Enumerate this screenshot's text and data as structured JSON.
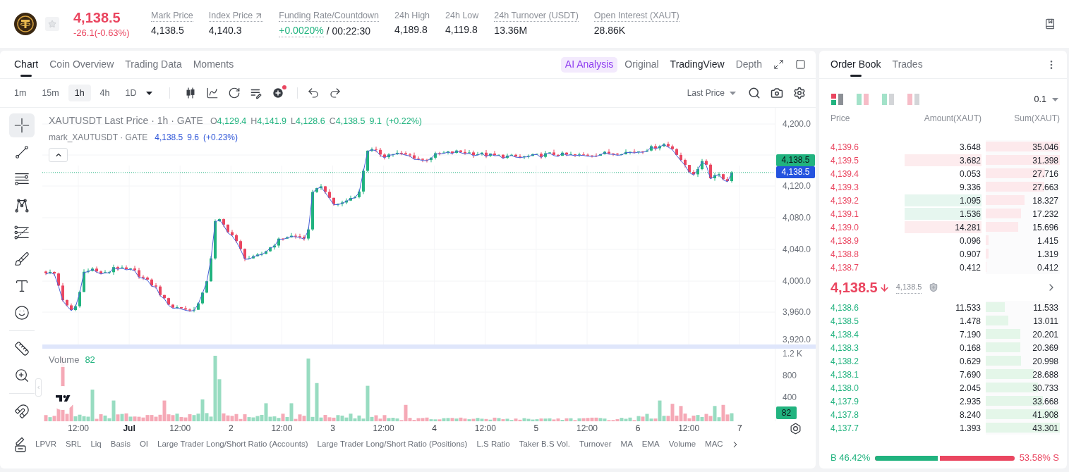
{
  "header": {
    "price": "4,138.5",
    "change": "-26.1(-0.63%)",
    "falling": true,
    "favorite": false,
    "stats": [
      {
        "label": "Mark Price",
        "value": "4,138.5",
        "dotted": true,
        "external_link": false,
        "positive": false
      },
      {
        "label": "Index Price",
        "value": "4,140.3",
        "dotted": true,
        "external_link": true,
        "positive": false
      },
      {
        "label": "Funding Rate/Countdown",
        "value": "+0.0020%",
        "countdown": "/ 00:22:30",
        "dotted": true,
        "external_link": false,
        "positive": true
      },
      {
        "label": "24h High",
        "value": "4,189.8",
        "dotted": false,
        "external_link": false,
        "positive": false
      },
      {
        "label": "24h Low",
        "value": "4,119.8",
        "dotted": false,
        "external_link": false,
        "positive": false
      },
      {
        "label": "24h Turnover (USDT)",
        "value": "13.36M",
        "dotted": true,
        "external_link": false,
        "positive": false
      },
      {
        "label": "Open Interest (XAUT)",
        "value": "28.86K",
        "dotted": true,
        "external_link": false,
        "positive": false
      }
    ]
  },
  "chart": {
    "tabs": [
      {
        "label": "Chart",
        "selected": true
      },
      {
        "label": "Coin Overview",
        "selected": false
      },
      {
        "label": "Trading Data",
        "selected": false
      },
      {
        "label": "Moments",
        "selected": false
      }
    ],
    "views": [
      {
        "label": "AI Analysis",
        "kind": "ai",
        "selected": false
      },
      {
        "label": "Original",
        "kind": "tab",
        "selected": false
      },
      {
        "label": "TradingView",
        "kind": "tab",
        "selected": true
      },
      {
        "label": "Depth",
        "kind": "tab",
        "selected": false
      }
    ],
    "intervals": [
      {
        "label": "1m",
        "selected": false
      },
      {
        "label": "15m",
        "selected": false
      },
      {
        "label": "1h",
        "selected": true
      },
      {
        "label": "4h",
        "selected": false
      },
      {
        "label": "1D",
        "selected": false
      }
    ],
    "toolbar": {
      "price_type": "Last Price",
      "notification_dot": true
    },
    "tools": [
      [
        {
          "kind": "crosshair",
          "selected": true
        },
        {
          "kind": "trend-line",
          "selected": false
        },
        {
          "kind": "parallel-lines",
          "selected": false
        },
        {
          "kind": "pattern",
          "selected": false
        },
        {
          "kind": "fib",
          "selected": false
        },
        {
          "kind": "brush",
          "selected": false
        },
        {
          "kind": "text",
          "selected": false
        },
        {
          "kind": "emoji",
          "selected": false
        }
      ],
      [
        {
          "kind": "ruler",
          "selected": false
        },
        {
          "kind": "zoom",
          "selected": false
        }
      ],
      [
        {
          "kind": "magnet",
          "selected": false
        }
      ]
    ],
    "legend": {
      "title": "XAUTUSDT Last Price · 1h · GATE",
      "positive": true,
      "ohlc": [
        {
          "key": "O",
          "value": "4,129.4"
        },
        {
          "key": "H",
          "value": "4,141.9"
        },
        {
          "key": "L",
          "value": "4,128.6"
        },
        {
          "key": "C",
          "value": "4,138.5"
        }
      ],
      "change": "9.1",
      "change_pct": "(+0.22%)",
      "mark_title": "mark_XAUTUSDT · GATE",
      "mark_values": [
        "4,138.5",
        "9.6",
        "(+0.23%)"
      ]
    },
    "price_axis": [
      "4,200.0",
      "4,120.0",
      "4,080.0",
      "4,040.0",
      "4,000.0",
      "3,960.0",
      "3,920.0"
    ],
    "price_tags": [
      {
        "text": "4,138.5",
        "kind": "last"
      },
      {
        "text": "4,138.5",
        "kind": "mark"
      }
    ],
    "volume": {
      "title": "Volume",
      "value": "82",
      "axis": [
        "1.2 K",
        "800",
        "400"
      ],
      "tag": "82"
    },
    "time_axis": [
      {
        "label": "12:00",
        "kind": "time"
      },
      {
        "label": "Jul",
        "kind": "month"
      },
      {
        "label": "12:00",
        "kind": "time"
      },
      {
        "label": "2",
        "kind": "day"
      },
      {
        "label": "12:00",
        "kind": "time"
      },
      {
        "label": "3",
        "kind": "day"
      },
      {
        "label": "12:00",
        "kind": "time"
      },
      {
        "label": "4",
        "kind": "day"
      },
      {
        "label": "12:00",
        "kind": "time"
      },
      {
        "label": "5",
        "kind": "day"
      },
      {
        "label": "12:00",
        "kind": "time"
      },
      {
        "label": "6",
        "kind": "day"
      },
      {
        "label": "12:00",
        "kind": "time"
      },
      {
        "label": "7",
        "kind": "day"
      }
    ],
    "indicators": [
      "LPVR",
      "SRL",
      "Liq",
      "Basis",
      "OI",
      "Large Trader Long/Short Ratio (Accounts)",
      "Large Trader Long/Short Ratio (Positions)",
      "L.S Ratio",
      "Taker B.S Vol.",
      "Turnover",
      "MA",
      "EMA",
      "Volume",
      "MAC"
    ]
  },
  "order_book": {
    "tabs": [
      {
        "label": "Order Book",
        "selected": true
      },
      {
        "label": "Trades",
        "selected": false
      }
    ],
    "views": [
      {
        "kind": "all",
        "selected": true
      },
      {
        "kind": "buy-sell",
        "selected": false
      },
      {
        "kind": "buy",
        "selected": false
      },
      {
        "kind": "sell",
        "selected": false
      }
    ],
    "precision": "0.1",
    "columns": [
      "Price",
      "Amount(XAUT)",
      "Sum(XAUT)"
    ],
    "asks": [
      {
        "price": "4,139.6",
        "amount": "3.648",
        "sum": "35.046",
        "level": 1.0,
        "flash_red": false,
        "flash_green": false
      },
      {
        "price": "4,139.5",
        "amount": "3.682",
        "sum": "31.398",
        "level": 1.0,
        "flash_red": true,
        "flash_green": false
      },
      {
        "price": "4,139.4",
        "amount": "0.053",
        "sum": "27.716",
        "level": 0.8,
        "flash_red": false,
        "flash_green": false
      },
      {
        "price": "4,139.3",
        "amount": "9.336",
        "sum": "27.663",
        "level": 0.79,
        "flash_red": false,
        "flash_green": false
      },
      {
        "price": "4,139.2",
        "amount": "1.095",
        "sum": "18.327",
        "level": 0.52,
        "flash_red": false,
        "flash_green": true
      },
      {
        "price": "4,139.1",
        "amount": "1.536",
        "sum": "17.232",
        "level": 0.48,
        "flash_red": false,
        "flash_green": true
      },
      {
        "price": "4,139.0",
        "amount": "14.281",
        "sum": "15.696",
        "level": 0.44,
        "flash_red": true,
        "flash_green": false
      },
      {
        "price": "4,138.9",
        "amount": "0.096",
        "sum": "1.415",
        "level": 0.04,
        "flash_red": false,
        "flash_green": false
      },
      {
        "price": "4,138.8",
        "amount": "0.907",
        "sum": "1.319",
        "level": 0.035,
        "flash_red": false,
        "flash_green": false
      },
      {
        "price": "4,138.7",
        "amount": "0.412",
        "sum": "0.412",
        "level": 0.01,
        "flash_red": false,
        "flash_green": false
      }
    ],
    "mid": {
      "price": "4,138.5",
      "falling": true,
      "mark": "4,138.5"
    },
    "bids": [
      {
        "price": "4,138.6",
        "amount": "11.533",
        "sum": "11.533",
        "level": 0.26,
        "flash_red": false,
        "flash_green": false
      },
      {
        "price": "4,138.5",
        "amount": "1.478",
        "sum": "13.011",
        "level": 0.3,
        "flash_red": false,
        "flash_green": false
      },
      {
        "price": "4,138.4",
        "amount": "7.190",
        "sum": "20.201",
        "level": 0.47,
        "flash_red": false,
        "flash_green": false
      },
      {
        "price": "4,138.3",
        "amount": "0.168",
        "sum": "20.369",
        "level": 0.47,
        "flash_red": false,
        "flash_green": false
      },
      {
        "price": "4,138.2",
        "amount": "0.629",
        "sum": "20.998",
        "level": 0.48,
        "flash_red": false,
        "flash_green": false
      },
      {
        "price": "4,138.1",
        "amount": "7.690",
        "sum": "28.688",
        "level": 0.65,
        "flash_red": false,
        "flash_green": false
      },
      {
        "price": "4,138.0",
        "amount": "2.045",
        "sum": "30.733",
        "level": 0.7,
        "flash_red": false,
        "flash_green": false
      },
      {
        "price": "4,137.9",
        "amount": "2.935",
        "sum": "33.668",
        "level": 0.77,
        "flash_red": false,
        "flash_green": false
      },
      {
        "price": "4,137.8",
        "amount": "8.240",
        "sum": "41.908",
        "level": 0.98,
        "flash_red": false,
        "flash_green": false
      },
      {
        "price": "4,137.7",
        "amount": "1.393",
        "sum": "43.301",
        "level": 1.0,
        "flash_red": false,
        "flash_green": false
      }
    ],
    "ratio": {
      "buy": "B 46.42%",
      "sell": "53.58% S",
      "level": 0.4642
    }
  }
}
